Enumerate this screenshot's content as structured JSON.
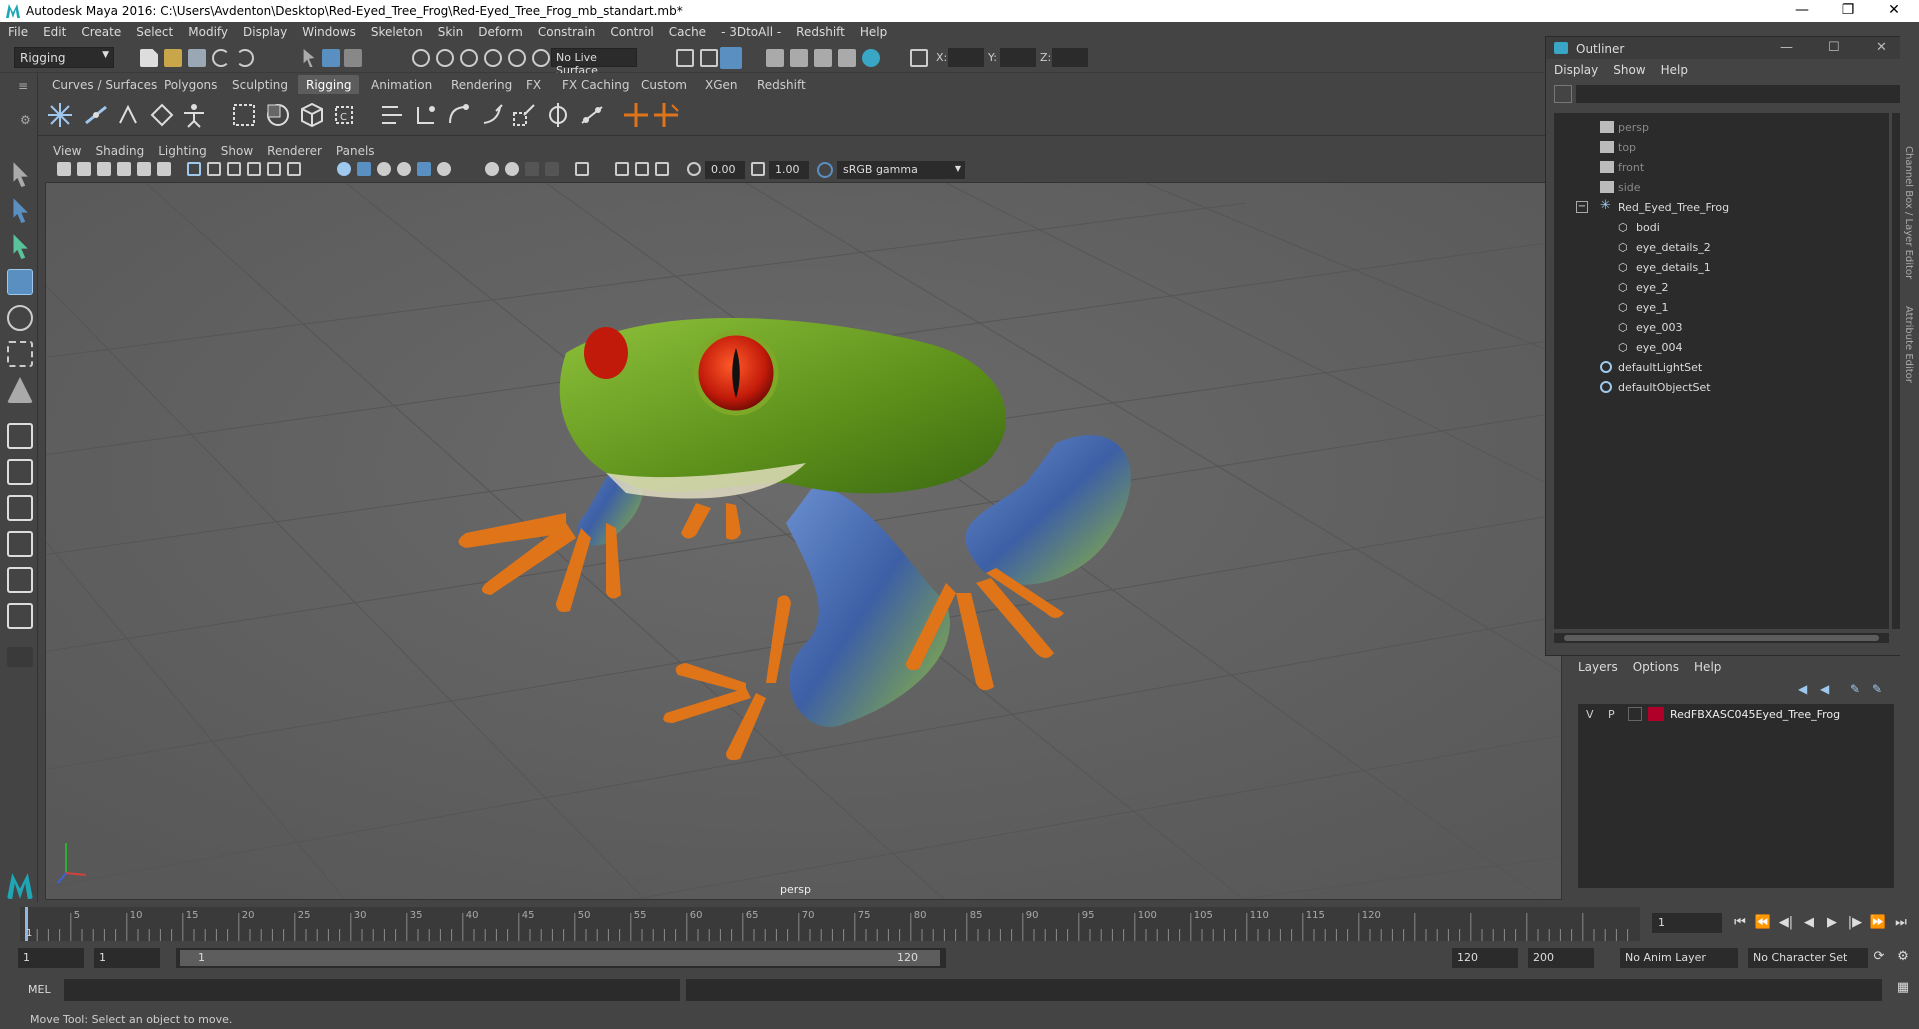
{
  "window": {
    "title": "Autodesk Maya 2016: C:\\Users\\Avdenton\\Desktop\\Red-Eyed_Tree_Frog\\Red-Eyed_Tree_Frog_mb_standart.mb*",
    "minimize": "—",
    "maximize": "❐",
    "close": "✕"
  },
  "menubar": {
    "items": [
      "File",
      "Edit",
      "Create",
      "Select",
      "Modify",
      "Display",
      "Windows",
      "Skeleton",
      "Skin",
      "Deform",
      "Constrain",
      "Control",
      "Cache",
      "- 3DtoAll -",
      "Redshift",
      "Help"
    ]
  },
  "statusline": {
    "menuset": "Rigging",
    "live_surface": "No Live Surface",
    "x_label": "X:",
    "y_label": "Y:",
    "z_label": "Z:"
  },
  "shelf": {
    "tabs": [
      "Curves / Surfaces",
      "Polygons",
      "Sculpting",
      "Rigging",
      "Animation",
      "Rendering",
      "FX",
      "FX Caching",
      "Custom",
      "XGen",
      "Redshift"
    ],
    "active_tab": "Rigging"
  },
  "viewport": {
    "menu": [
      "View",
      "Shading",
      "Lighting",
      "Show",
      "Renderer",
      "Panels"
    ],
    "exposure": "0.00",
    "gamma": "1.00",
    "color_space": "sRGB gamma",
    "camera_label": "persp"
  },
  "outliner": {
    "title": "Outliner",
    "menu": [
      "Display",
      "Show",
      "Help"
    ],
    "items": [
      {
        "label": "persp",
        "type": "camera",
        "dim": true
      },
      {
        "label": "top",
        "type": "camera",
        "dim": true
      },
      {
        "label": "front",
        "type": "camera",
        "dim": true
      },
      {
        "label": "side",
        "type": "camera",
        "dim": true
      },
      {
        "label": "Red_Eyed_Tree_Frog",
        "type": "group",
        "dim": false
      },
      {
        "label": "bodi",
        "type": "mesh",
        "dim": false
      },
      {
        "label": "eye_details_2",
        "type": "mesh",
        "dim": false
      },
      {
        "label": "eye_details_1",
        "type": "mesh",
        "dim": false
      },
      {
        "label": "eye_2",
        "type": "mesh",
        "dim": false
      },
      {
        "label": "eye_1",
        "type": "mesh",
        "dim": false
      },
      {
        "label": "eye_003",
        "type": "mesh",
        "dim": false
      },
      {
        "label": "eye_004",
        "type": "mesh",
        "dim": false
      },
      {
        "label": "defaultLightSet",
        "type": "set",
        "dim": false
      },
      {
        "label": "defaultObjectSet",
        "type": "set",
        "dim": false
      }
    ]
  },
  "side_tabs": {
    "channel_box": "Channel Box / Layer Editor",
    "attribute_editor": "Attribute Editor"
  },
  "layers": {
    "menu": [
      "Layers",
      "Options",
      "Help"
    ],
    "rows": [
      {
        "v": "V",
        "p": "P",
        "color": "#b0002a",
        "name": "RedFBXASC045Eyed_Tree_Frog"
      }
    ]
  },
  "timeslider": {
    "labels": [
      "5",
      "10",
      "15",
      "20",
      "25",
      "30",
      "35",
      "40",
      "45",
      "50",
      "55",
      "60",
      "65",
      "70",
      "75",
      "80",
      "85",
      "90",
      "95",
      "100",
      "105",
      "110",
      "115",
      "120"
    ],
    "start_mark": "1",
    "current_frame": "1"
  },
  "range": {
    "start": "1",
    "playback_start": "1",
    "slider_start": "1",
    "slider_end": "120",
    "playback_end": "120",
    "end": "200",
    "anim_layer": "No Anim Layer",
    "character_set": "No Character Set"
  },
  "cmdline": {
    "label": "MEL"
  },
  "helpline": {
    "text": "Move Tool: Select an object to move."
  },
  "colors": {
    "bg": "#444444",
    "viewport": "#666666",
    "accent": "#5a8fc2",
    "frog_green": "#6ea11e",
    "frog_orange": "#e07418",
    "frog_blue": "#3f63a8",
    "frog_eye": "#c8200e"
  }
}
